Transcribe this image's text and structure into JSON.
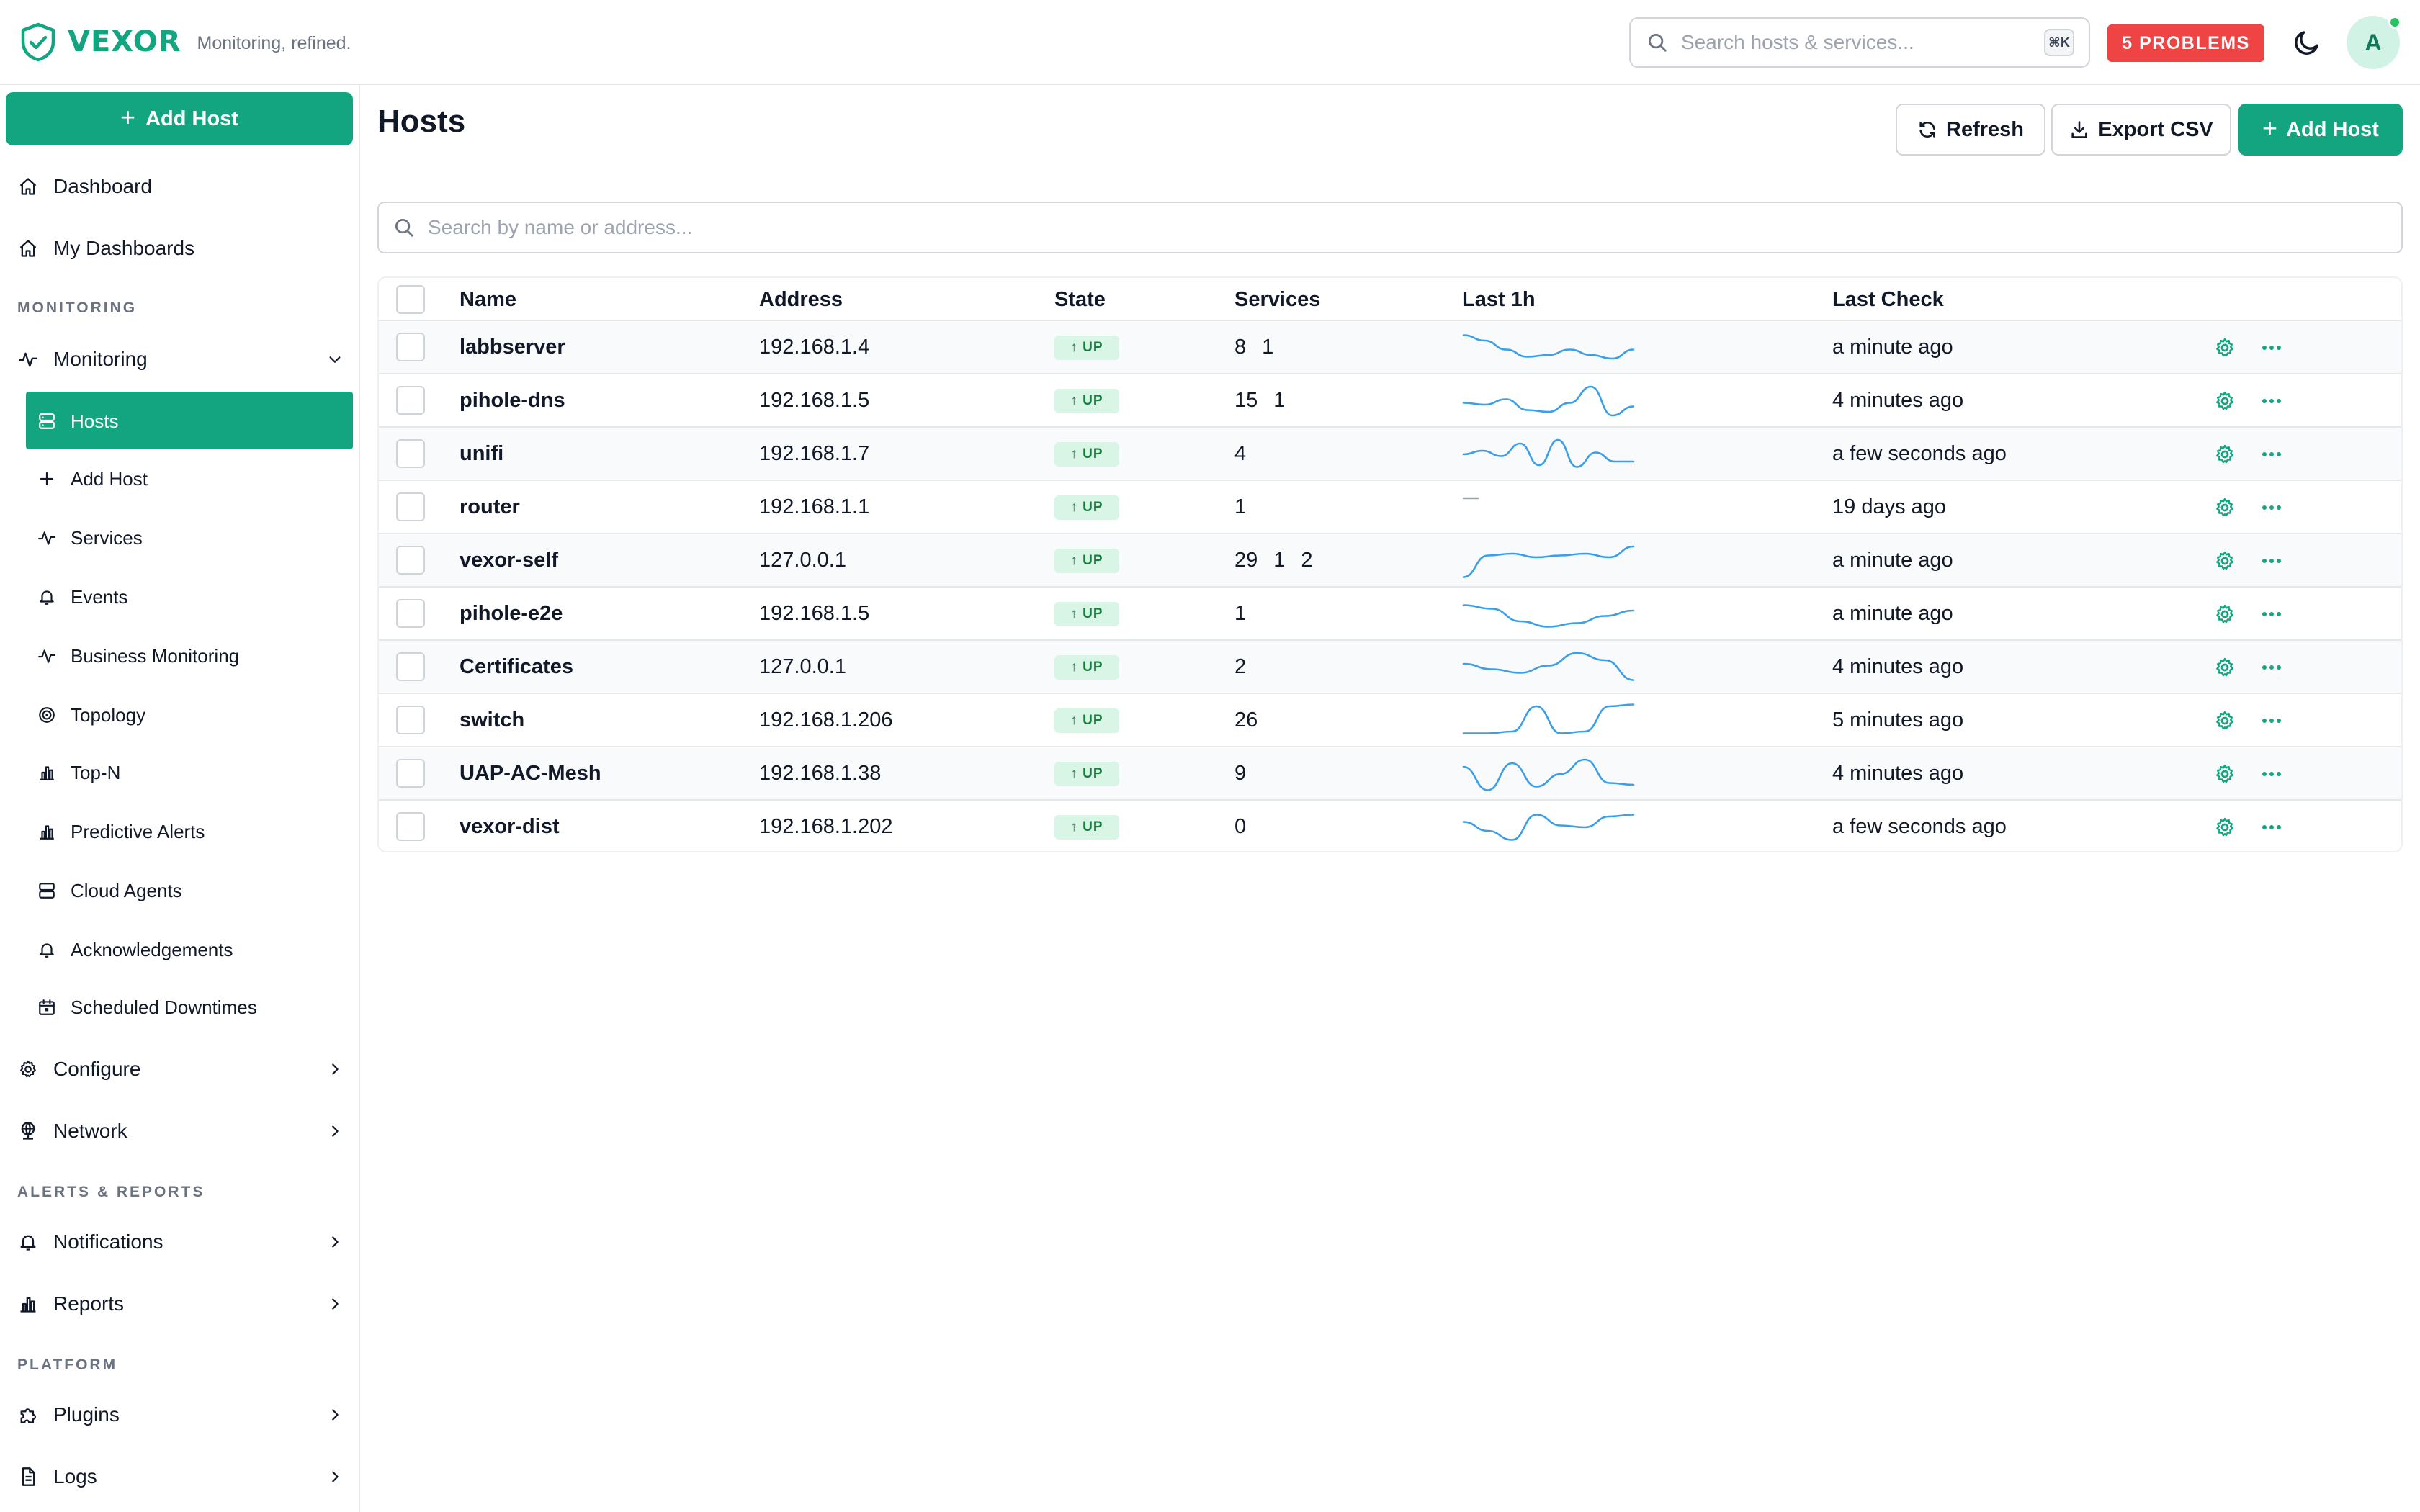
{
  "brand": {
    "name": "VEXOR",
    "tagline": "Monitoring, refined.",
    "accent": "#12a57f"
  },
  "topbar": {
    "search_placeholder": "Search hosts & services...",
    "shortcut": "⌘K",
    "problems_label": "5 PROBLEMS",
    "avatar_initial": "A"
  },
  "sidebar": {
    "add_host_label": "Add Host",
    "top_items": [
      {
        "label": "Dashboard",
        "icon": "home-icon"
      },
      {
        "label": "My Dashboards",
        "icon": "home-icon"
      }
    ],
    "sections": {
      "monitoring": "MONITORING",
      "alerts_reports": "ALERTS & REPORTS",
      "platform": "PLATFORM"
    },
    "monitoring_label": "Monitoring",
    "monitoring_items": [
      {
        "label": "Hosts",
        "icon": "server-icon",
        "active": true
      },
      {
        "label": "Add Host",
        "icon": "plus-icon"
      },
      {
        "label": "Services",
        "icon": "activity-icon"
      },
      {
        "label": "Events",
        "icon": "bell-icon"
      },
      {
        "label": "Business Monitoring",
        "icon": "activity-icon"
      },
      {
        "label": "Topology",
        "icon": "radar-icon"
      },
      {
        "label": "Top-N",
        "icon": "bar-chart-icon"
      },
      {
        "label": "Predictive Alerts",
        "icon": "bar-chart-icon"
      },
      {
        "label": "Cloud Agents",
        "icon": "server-icon"
      },
      {
        "label": "Acknowledgements",
        "icon": "bell-icon"
      },
      {
        "label": "Scheduled Downtimes",
        "icon": "calendar-icon"
      }
    ],
    "configure_label": "Configure",
    "network_label": "Network",
    "notifications_label": "Notifications",
    "reports_label": "Reports",
    "plugins_label": "Plugins",
    "logs_label": "Logs"
  },
  "main": {
    "title": "Hosts",
    "refresh_label": "Refresh",
    "export_label": "Export CSV",
    "add_host_label": "Add Host",
    "filter_placeholder": "Search by name or address...",
    "columns": {
      "name": "Name",
      "address": "Address",
      "state": "State",
      "services": "Services",
      "last1h": "Last 1h",
      "last_check": "Last Check"
    },
    "rows": [
      {
        "name": "labbserver",
        "address": "192.168.1.4",
        "state": "UP",
        "services": [
          "8",
          "1",
          ""
        ],
        "last_check": "a minute ago",
        "spark": [
          0.15,
          0.3,
          0.55,
          0.75,
          0.7,
          0.55,
          0.7,
          0.8,
          0.55
        ]
      },
      {
        "name": "pihole-dns",
        "address": "192.168.1.5",
        "state": "UP",
        "services": [
          "15",
          "1",
          ""
        ],
        "last_check": "4 minutes ago",
        "spark": [
          0.55,
          0.6,
          0.45,
          0.75,
          0.8,
          0.55,
          0.1,
          0.9,
          0.65
        ]
      },
      {
        "name": "unifi",
        "address": "192.168.1.7",
        "state": "UP",
        "services": [
          "4",
          "",
          ""
        ],
        "last_check": "a few seconds ago",
        "spark": [
          0.5,
          0.4,
          0.55,
          0.2,
          0.8,
          0.1,
          0.85,
          0.45,
          0.7,
          0.7
        ]
      },
      {
        "name": "router",
        "address": "192.168.1.1",
        "state": "UP",
        "services": [
          "1",
          "",
          ""
        ],
        "last_check": "19 days ago",
        "spark": [
          0.5,
          0.5
        ]
      },
      {
        "name": "vexor-self",
        "address": "127.0.0.1",
        "state": "UP",
        "services": [
          "29",
          "1",
          "2"
        ],
        "last_check": "a minute ago",
        "spark": [
          0.95,
          0.35,
          0.3,
          0.4,
          0.35,
          0.3,
          0.4,
          0.1
        ]
      },
      {
        "name": "pihole-e2e",
        "address": "192.168.1.5",
        "state": "UP",
        "services": [
          "1",
          "",
          ""
        ],
        "last_check": "a minute ago",
        "spark": [
          0.25,
          0.35,
          0.7,
          0.85,
          0.75,
          0.55,
          0.4
        ]
      },
      {
        "name": "Certificates",
        "address": "127.0.0.1",
        "state": "UP",
        "services": [
          "2",
          "",
          ""
        ],
        "last_check": "4 minutes ago",
        "spark": [
          0.4,
          0.55,
          0.65,
          0.45,
          0.1,
          0.3,
          0.85
        ]
      },
      {
        "name": "switch",
        "address": "192.168.1.206",
        "state": "UP",
        "services": [
          "26",
          "",
          ""
        ],
        "last_check": "5 minutes ago",
        "spark": [
          0.85,
          0.85,
          0.8,
          0.1,
          0.85,
          0.8,
          0.1,
          0.05
        ]
      },
      {
        "name": "UAP-AC-Mesh",
        "address": "192.168.1.38",
        "state": "UP",
        "services": [
          "9",
          "",
          ""
        ],
        "last_check": "4 minutes ago",
        "spark": [
          0.3,
          0.95,
          0.2,
          0.85,
          0.5,
          0.1,
          0.75,
          0.8
        ]
      },
      {
        "name": "vexor-dist",
        "address": "192.168.1.202",
        "state": "UP",
        "services": [
          "0",
          "",
          ""
        ],
        "last_check": "a few seconds ago",
        "spark": [
          0.35,
          0.6,
          0.85,
          0.15,
          0.45,
          0.5,
          0.2,
          0.15
        ]
      }
    ]
  }
}
